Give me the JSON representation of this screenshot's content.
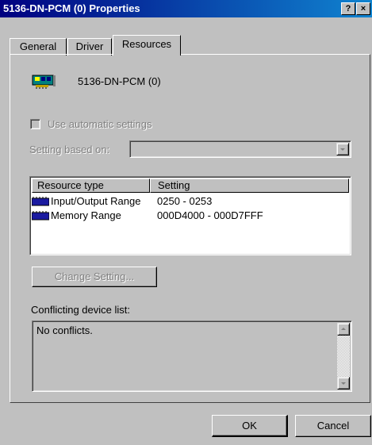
{
  "window": {
    "title": "5136-DN-PCM (0) Properties",
    "help_button": "?",
    "close_button": "×"
  },
  "tabs": [
    {
      "label": "General"
    },
    {
      "label": "Driver"
    },
    {
      "label": "Resources"
    }
  ],
  "device": {
    "icon": "network-card-icon",
    "name": "5136-DN-PCM (0)"
  },
  "auto_settings": {
    "label": "Use automatic settings",
    "checked": false
  },
  "setting_based_on": {
    "label": "Setting based on:",
    "value": ""
  },
  "resources_table": {
    "headers": [
      "Resource type",
      "Setting"
    ],
    "rows": [
      {
        "icon": "resource-chip-icon",
        "type": "Input/Output Range",
        "setting": "0250 - 0253"
      },
      {
        "icon": "resource-chip-icon",
        "type": "Memory Range",
        "setting": "000D4000 - 000D7FFF"
      }
    ]
  },
  "change_setting_button": "Change Setting...",
  "conflicts": {
    "label": "Conflicting device list:",
    "text": "No conflicts."
  },
  "footer": {
    "ok": "OK",
    "cancel": "Cancel"
  },
  "colors": {
    "title_bar": "#000080",
    "face": "#c0c0c0",
    "chip_blue": "#1a1aa0"
  }
}
